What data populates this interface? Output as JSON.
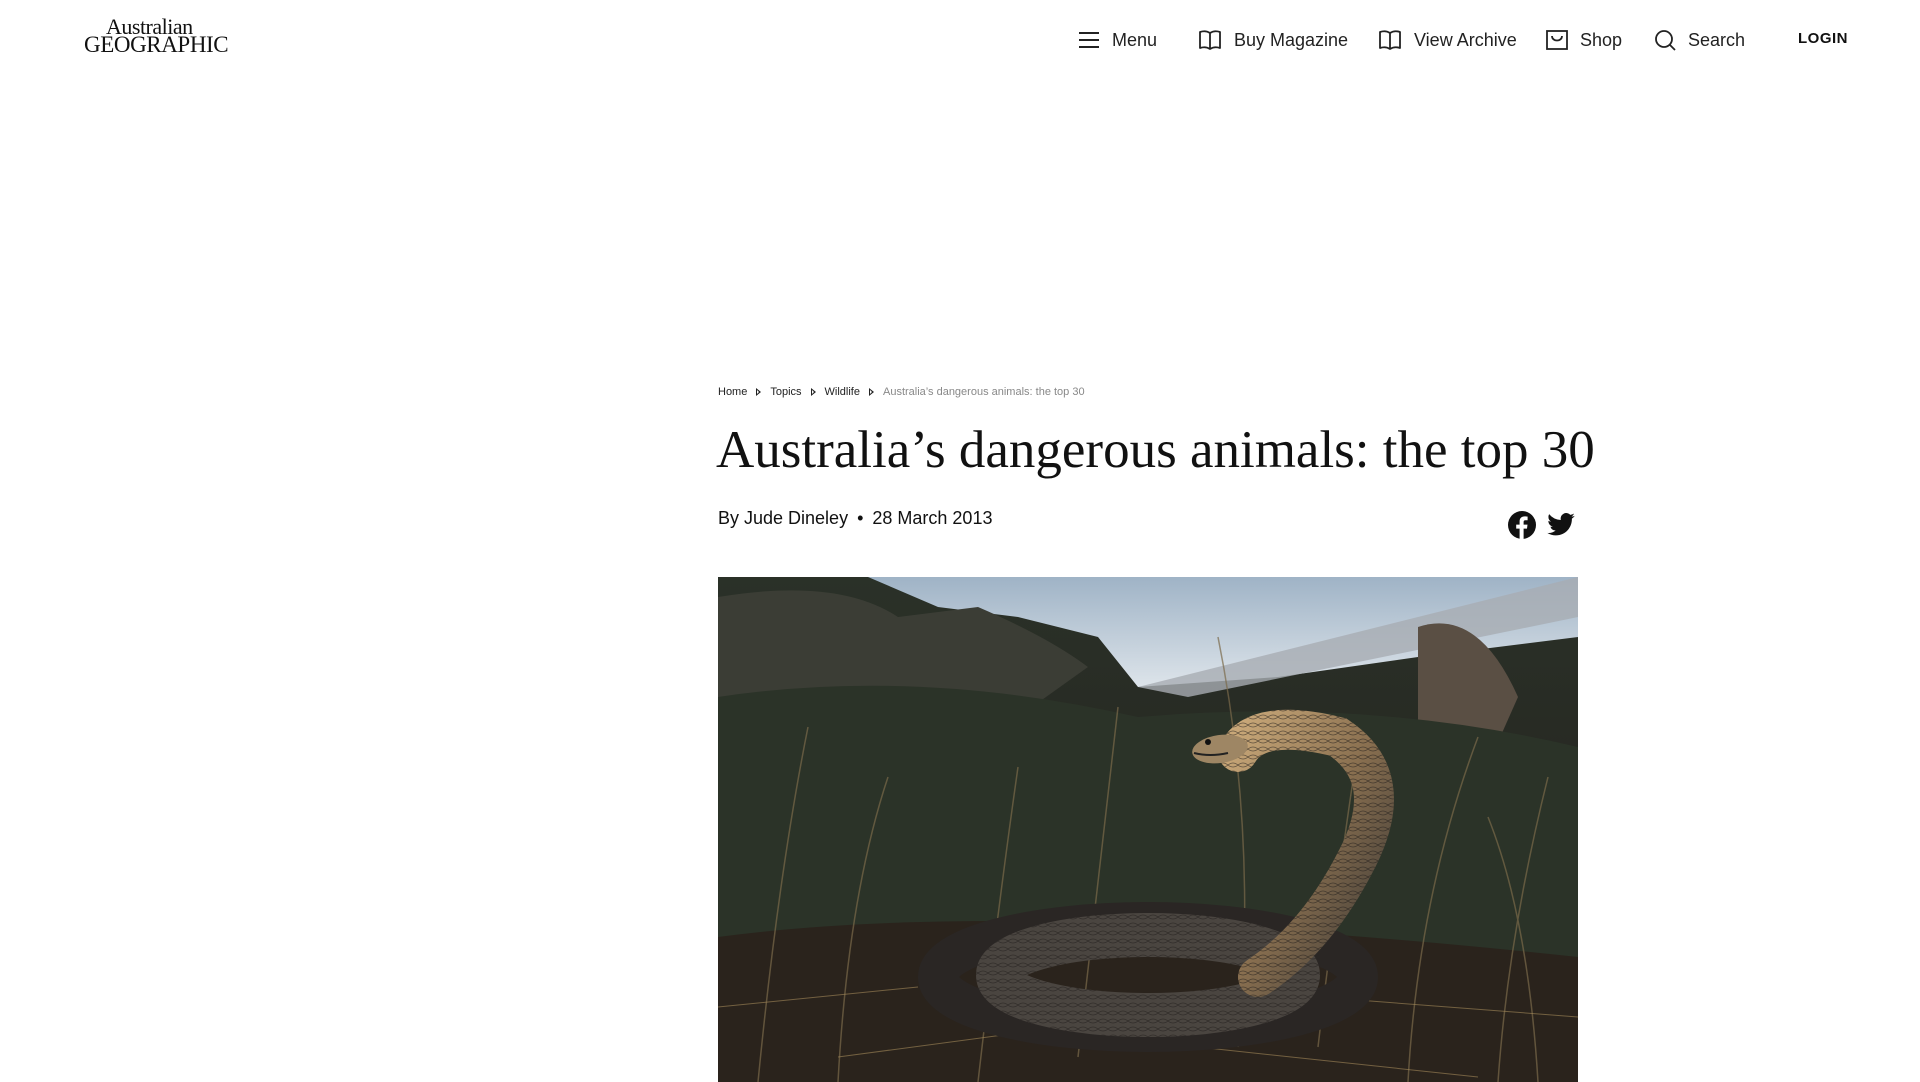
{
  "header": {
    "logo": {
      "line1": "Australian",
      "line2": "GEOGRAPHIC"
    },
    "nav": {
      "menu": "Menu",
      "buy_magazine": "Buy Magazine",
      "view_archive": "View Archive",
      "shop": "Shop",
      "search": "Search",
      "login": "LOGIN"
    },
    "icons": [
      "menu-icon",
      "book-icon",
      "book-icon",
      "shop-icon",
      "search-icon"
    ]
  },
  "breadcrumb": {
    "items": [
      "Home",
      "Topics",
      "Wildlife"
    ],
    "current": "Australia’s dangerous animals: the top 30"
  },
  "article": {
    "title": "Australia’s dangerous animals: the top 30",
    "author": "By Jude Dineley",
    "separator": "•",
    "date": "28 March 2013",
    "share_icons": [
      "facebook-icon",
      "twitter-icon"
    ],
    "hero_image": "snake-photo"
  },
  "colors": {
    "text": "#111111",
    "muted": "#888888",
    "background": "#ffffff"
  }
}
